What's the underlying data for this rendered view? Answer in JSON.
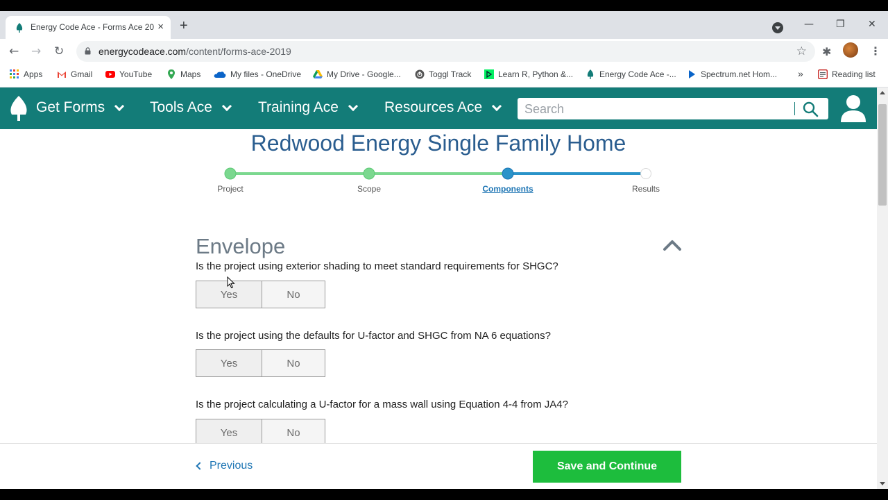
{
  "browser": {
    "tab_title": "Energy Code Ace - Forms Ace 20",
    "tab_close": "×",
    "new_tab": "+",
    "url_domain": "energycodeace.com",
    "url_path": "/content/forms-ace-2019",
    "window_controls": {
      "minimize": "—",
      "restore": "❐",
      "close": "✕"
    },
    "nav": {
      "back": "←",
      "forward": "→",
      "reload": "↻"
    },
    "star": "☆",
    "extensions": "✱",
    "menu": "⋮"
  },
  "bookmarks": {
    "items": [
      {
        "label": "Apps",
        "icon": "apps-grid-icon",
        "color": "#4285f4"
      },
      {
        "label": "Gmail",
        "icon": "gmail-icon",
        "color": "#ea4335"
      },
      {
        "label": "YouTube",
        "icon": "youtube-icon",
        "color": "#ff0000"
      },
      {
        "label": "Maps",
        "icon": "maps-pin-icon",
        "color": "#34a853"
      },
      {
        "label": "My files - OneDrive",
        "icon": "onedrive-cloud-icon",
        "color": "#0a64c8"
      },
      {
        "label": "My Drive - Google...",
        "icon": "google-drive-icon",
        "color": "#fbbc04"
      },
      {
        "label": "Toggl Track",
        "icon": "toggl-icon",
        "color": "#555555"
      },
      {
        "label": "Learn R, Python &...",
        "icon": "datacamp-icon",
        "color": "#03ef62"
      },
      {
        "label": "Energy Code Ace -...",
        "icon": "energy-code-ace-leaf-icon",
        "color": "#137c78"
      },
      {
        "label": "Spectrum.net Hom...",
        "icon": "spectrum-play-icon",
        "color": "#0a64c8"
      }
    ],
    "overflow": "»",
    "reading_list": "Reading list"
  },
  "site_nav": {
    "items": [
      {
        "label": "Get Forms"
      },
      {
        "label": "Tools Ace"
      },
      {
        "label": "Training Ace"
      },
      {
        "label": "Resources Ace"
      }
    ],
    "search_placeholder": "Search",
    "brand_color": "#137c78"
  },
  "page": {
    "title": "Redwood Energy Single Family Home",
    "steps": [
      {
        "label": "Project",
        "state": "complete"
      },
      {
        "label": "Scope",
        "state": "complete"
      },
      {
        "label": "Components",
        "state": "current"
      },
      {
        "label": "Results",
        "state": "upcoming"
      }
    ],
    "section_title": "Envelope",
    "questions": [
      {
        "text": "Is the project using exterior shading to meet standard requirements for SHGC?",
        "yes": "Yes",
        "no": "No"
      },
      {
        "text": "Is the project using the defaults for U-factor and SHGC from NA 6 equations?",
        "yes": "Yes",
        "no": "No"
      },
      {
        "text": "Is the project calculating a U-factor for a mass wall using Equation 4-4 from JA4?",
        "yes": "Yes",
        "no": "No"
      }
    ]
  },
  "footer": {
    "previous_label": "Previous",
    "save_label": "Save and Continue",
    "save_color": "#1dbd3d"
  }
}
